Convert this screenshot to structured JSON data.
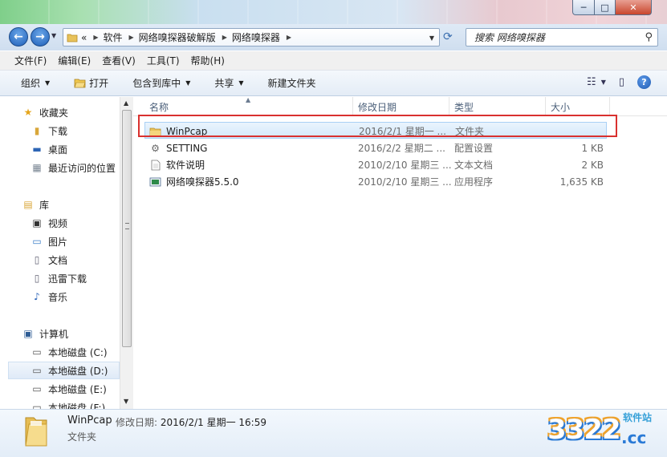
{
  "window": {
    "controls": {
      "minimize": "─",
      "maximize": "□",
      "close": "✕"
    }
  },
  "address": {
    "overflow": "«",
    "crumbs": [
      "软件",
      "网络嗅探器破解版",
      "网络嗅探器"
    ],
    "search_placeholder": "搜索 网络嗅探器"
  },
  "menu": [
    "文件(F)",
    "编辑(E)",
    "查看(V)",
    "工具(T)",
    "帮助(H)"
  ],
  "toolbar": {
    "organize": "组织",
    "open": "打开",
    "include_library": "包含到库中",
    "share": "共享",
    "new_folder": "新建文件夹"
  },
  "nav": {
    "favorites": {
      "label": "收藏夹",
      "items": [
        "下载",
        "桌面",
        "最近访问的位置"
      ]
    },
    "libraries": {
      "label": "库",
      "items": [
        "视频",
        "图片",
        "文档",
        "迅雷下载",
        "音乐"
      ]
    },
    "computer": {
      "label": "计算机",
      "items": [
        "本地磁盘 (C:)",
        "本地磁盘 (D:)",
        "本地磁盘 (E:)",
        "本地磁盘 (F:)"
      ]
    }
  },
  "columns": {
    "name": "名称",
    "date": "修改日期",
    "type": "类型",
    "size": "大小"
  },
  "files": [
    {
      "name": "WinPcap",
      "date": "2016/2/1 星期一 ...",
      "type": "文件夹",
      "size": "",
      "icon": "folder-icon"
    },
    {
      "name": "SETTING",
      "date": "2016/2/2 星期二 ...",
      "type": "配置设置",
      "size": "1 KB",
      "icon": "settings-file-icon"
    },
    {
      "name": "软件说明",
      "date": "2010/2/10 星期三 ...",
      "type": "文本文档",
      "size": "2 KB",
      "icon": "text-file-icon"
    },
    {
      "name": "网络嗅探器5.5.0",
      "date": "2010/2/10 星期三 ...",
      "type": "应用程序",
      "size": "1,635 KB",
      "icon": "app-icon"
    }
  ],
  "details": {
    "name": "WinPcap",
    "date_label": "修改日期:",
    "date_value": "2016/2/1 星期一 16:59",
    "type": "文件夹"
  },
  "watermark": {
    "num": "3322",
    "cc": ".cc",
    "site": "软件站"
  }
}
